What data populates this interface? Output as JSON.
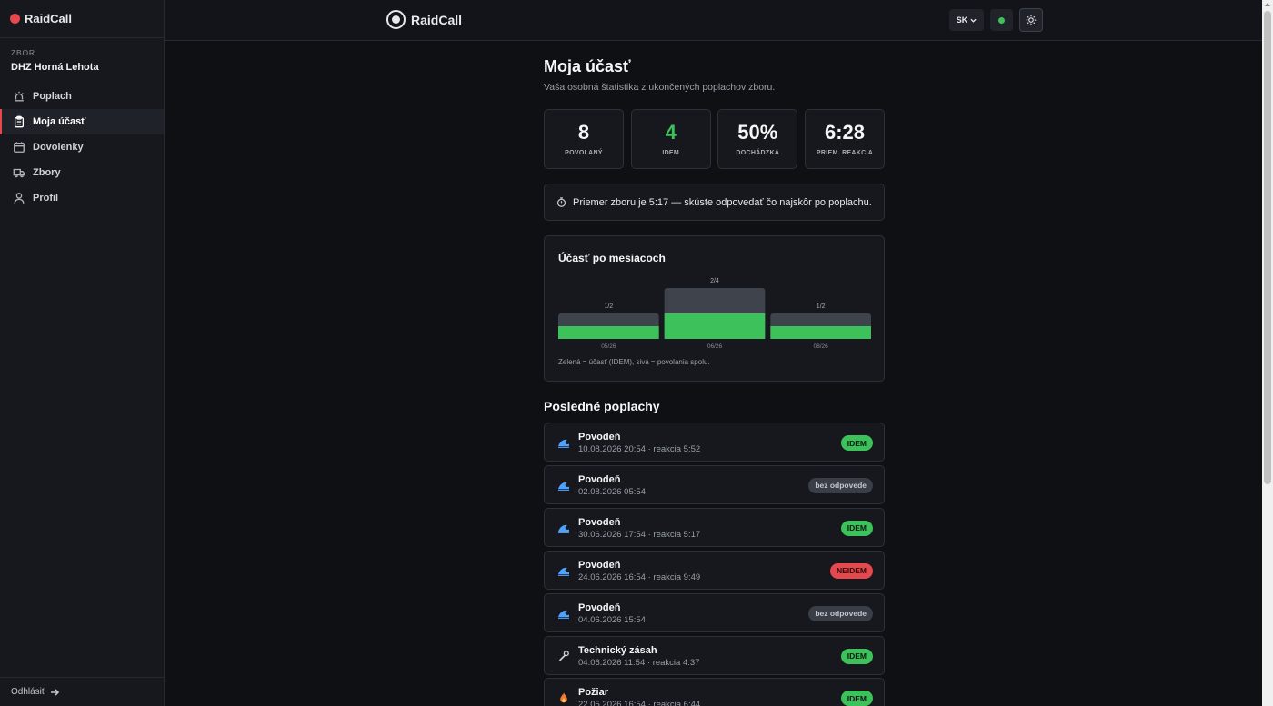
{
  "sidebar": {
    "brand": "RaidCall",
    "section_label": "ZBOR",
    "org_name": "DHZ Horná Lehota",
    "items": [
      {
        "label": "Poplach",
        "icon": "siren-icon"
      },
      {
        "label": "Moja účasť",
        "icon": "clipboard-icon"
      },
      {
        "label": "Dovolenky",
        "icon": "calendar-icon"
      },
      {
        "label": "Zbory",
        "icon": "truck-icon"
      },
      {
        "label": "Profil",
        "icon": "user-icon"
      }
    ],
    "active_item": "Moja účasť",
    "logout_label": "Odhlásiť"
  },
  "topbar": {
    "logo_text": "RaidCall",
    "language": "SK",
    "status_color": "#3cc15b"
  },
  "main": {
    "title": "Moja účasť",
    "subtitle": "Vaša osobná štatistika z ukončených poplachov zboru.",
    "stats": [
      {
        "value": "8",
        "label": "POVOLANÝ"
      },
      {
        "value": "4",
        "label": "IDEM"
      },
      {
        "value": "50%",
        "label": "DOCHÁDZKA"
      },
      {
        "value": "6:28",
        "label": "PRIEM. REAKCIA"
      }
    ],
    "info_text": "Priemer zboru je 5:17 — skúste odpovedať čo najskôr po poplachu."
  },
  "chart_data": {
    "type": "bar",
    "title": "Účasť po mesiacoch",
    "categories": [
      "05/26",
      "06/26",
      "08/26"
    ],
    "series": [
      {
        "values": [
          2,
          4,
          2
        ],
        "color": "#3f434c"
      },
      {
        "values": [
          1,
          2,
          1
        ],
        "color": "#3cc15b"
      }
    ],
    "data_labels": [
      "1/2",
      "2/4",
      "1/2"
    ],
    "note": "Zelená = účasť (IDEM), sivá = povolania spolu."
  },
  "recent": {
    "title": "Posledné poplachy",
    "alarms": [
      {
        "type": "Povodeň",
        "meta": "10.08.2026 20:54 · reakcia 5:52",
        "status": "IDEM",
        "icon": "wave-icon"
      },
      {
        "type": "Povodeň",
        "meta": "02.08.2026 05:54",
        "status": "bez odpovede",
        "icon": "wave-icon"
      },
      {
        "type": "Povodeň",
        "meta": "30.06.2026 17:54 · reakcia 5:17",
        "status": "IDEM",
        "icon": "wave-icon"
      },
      {
        "type": "Povodeň",
        "meta": "24.06.2026 16:54 · reakcia 9:49",
        "status": "NEIDEM",
        "icon": "wave-icon"
      },
      {
        "type": "Povodeň",
        "meta": "04.06.2026 15:54",
        "status": "bez odpovede",
        "icon": "wave-icon"
      },
      {
        "type": "Technický zásah",
        "meta": "04.06.2026 11:54 · reakcia 4:37",
        "status": "IDEM",
        "icon": "wrench-icon"
      },
      {
        "type": "Požiar",
        "meta": "22.05.2026 16:54 · reakcia 6:44",
        "status": "IDEM",
        "icon": "fire-icon"
      }
    ]
  }
}
